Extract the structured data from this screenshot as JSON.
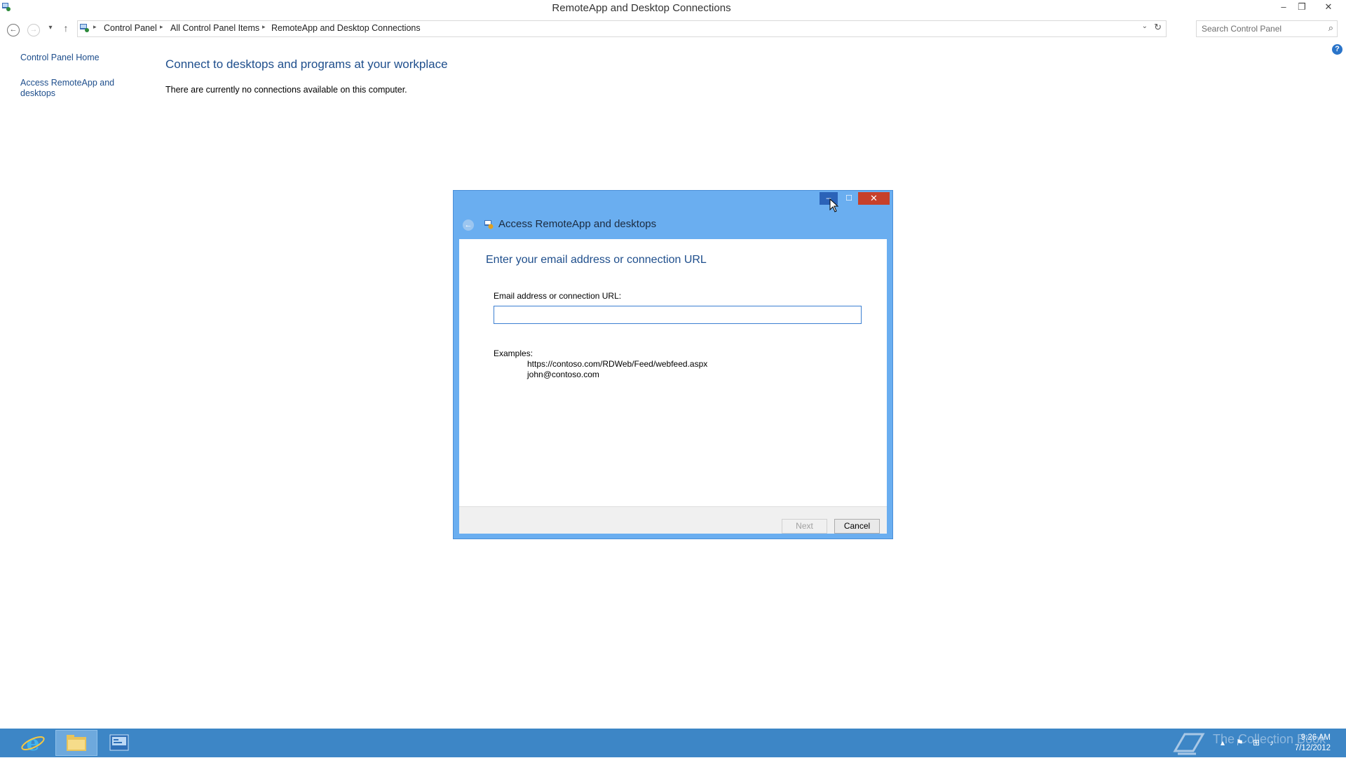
{
  "window": {
    "title": "RemoteApp and Desktop Connections",
    "minimize_glyph": "–",
    "restore_glyph": "❐",
    "close_glyph": "✕"
  },
  "nav": {
    "back_glyph": "←",
    "forward_glyph": "→",
    "recent_glyph": "▾",
    "up_glyph": "↑",
    "breadcrumbs": [
      "Control Panel",
      "All Control Panel Items",
      "RemoteApp and Desktop Connections"
    ],
    "breadcrumb_sep": "▸",
    "dropdown_glyph": "⌄",
    "refresh_glyph": "↻",
    "search_placeholder": "Search Control Panel",
    "search_glyph": "⌕"
  },
  "sidebar": {
    "home_link": "Control Panel Home",
    "access_link": "Access RemoteApp and desktops"
  },
  "help_glyph": "?",
  "main": {
    "heading": "Connect to desktops and programs at your workplace",
    "status_text": "There are currently no connections available on this computer."
  },
  "dialog": {
    "title": "Access RemoteApp and desktops",
    "back_glyph": "←",
    "min_glyph": "–",
    "max_glyph": "☐",
    "close_glyph": "✕",
    "heading": "Enter your email address or connection URL",
    "field_label": "Email address or connection URL:",
    "field_value": "",
    "examples_label": "Examples:",
    "examples": [
      "https://contoso.com/RDWeb/Feed/webfeed.aspx",
      "john@contoso.com"
    ],
    "next_label": "Next",
    "cancel_label": "Cancel"
  },
  "taskbar": {
    "watermark": "The Collection Book",
    "time": "9:26 AM",
    "date": "7/12/2012",
    "tray_glyphs": [
      "▴",
      "⚑",
      "⊞",
      "♪"
    ]
  },
  "colors": {
    "dialog_frame": "#6aaef0",
    "taskbar": "#3d86c6",
    "link": "#1e4e8c",
    "close_red": "#c7402a"
  }
}
